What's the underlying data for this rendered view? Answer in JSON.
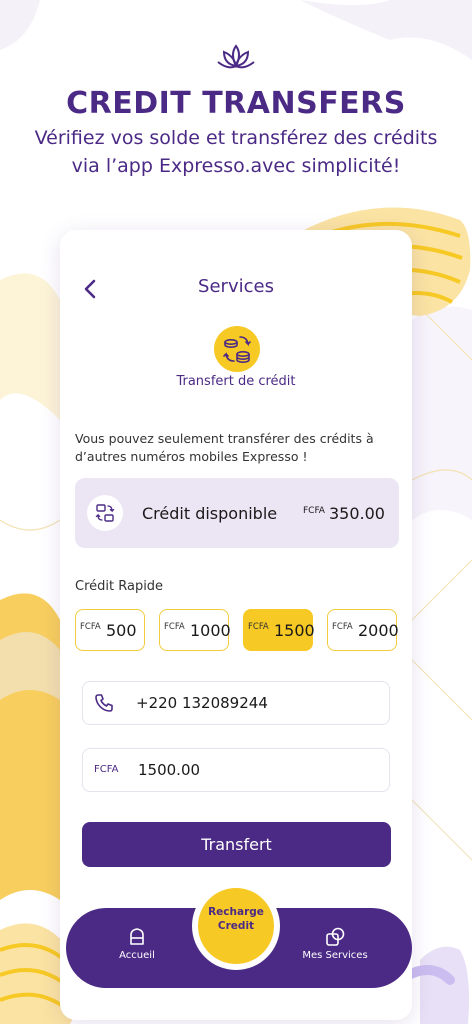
{
  "promo": {
    "headline": "CREDIT TRANSFERS",
    "subline": "Vérifiez vos solde et transférez des crédits via l’app Expresso.avec simplicité!"
  },
  "screen": {
    "title": "Services",
    "service_label": "Transfert de crédit",
    "info_text": "Vous pouvez seulement transférer des crédits à d’autres numéros mobiles Expresso !"
  },
  "balance": {
    "label": "Crédit disponible",
    "currency": "FCFA",
    "amount": "350.00"
  },
  "quick_credit": {
    "label": "Crédit Rapide",
    "options": [
      {
        "currency": "FCFA",
        "value": "500"
      },
      {
        "currency": "FCFA",
        "value": "1000"
      },
      {
        "currency": "FCFA",
        "value": "1500"
      },
      {
        "currency": "FCFA",
        "value": "2000"
      }
    ],
    "selected": "1500"
  },
  "form": {
    "phone": "+220 132089244",
    "amount_currency": "FCFA",
    "amount": "1500.00",
    "submit_label": "Transfert"
  },
  "nav": {
    "home_label": "Accueil",
    "fab_label_line1": "Recharge",
    "fab_label_line2": "Credit",
    "services_label": "Mes Services"
  },
  "colors": {
    "brand_purple": "#4b2a86",
    "brand_yellow": "#f7c924",
    "card_tint": "#ebe5f4"
  },
  "icons": {
    "back": "chevron-left-icon",
    "service": "coins-transfer-icon",
    "balance": "transfer-cards-icon",
    "phone": "phone-icon",
    "home": "home-icon",
    "services": "services-icon",
    "logo": "lotus-icon"
  }
}
